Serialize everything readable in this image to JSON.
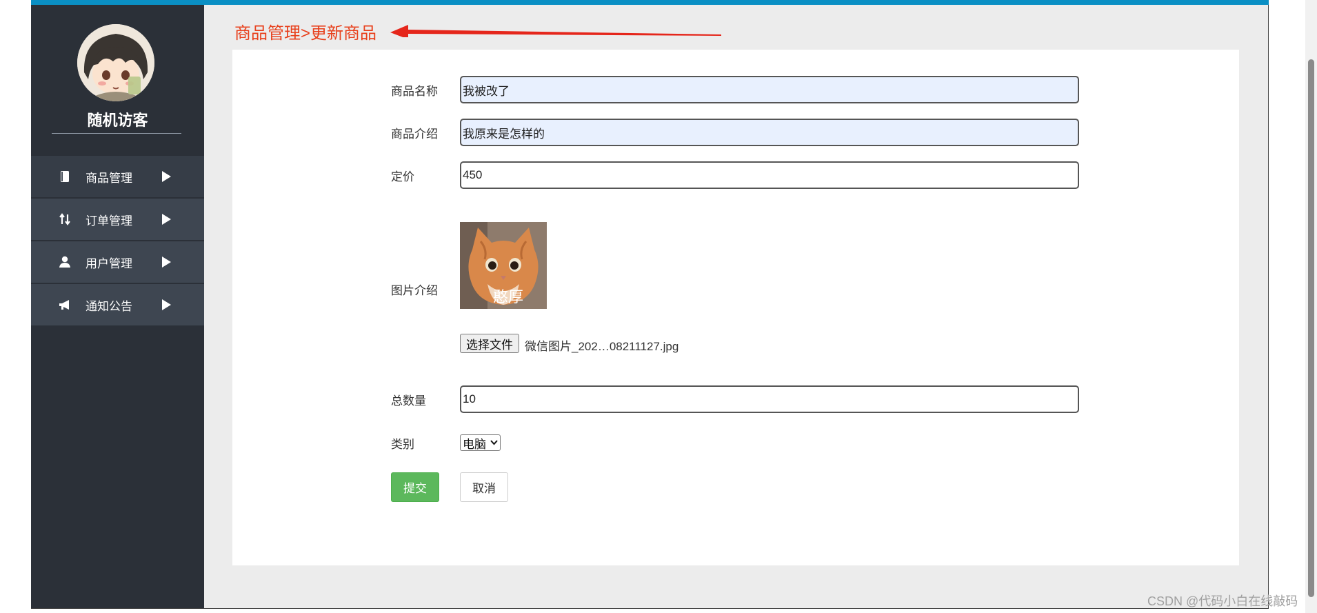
{
  "sidebar": {
    "username": "随机访客",
    "items": [
      {
        "label": "商品管理",
        "icon": "book-icon"
      },
      {
        "label": "订单管理",
        "icon": "sort-arrows-icon"
      },
      {
        "label": "用户管理",
        "icon": "user-icon"
      },
      {
        "label": "通知公告",
        "icon": "megaphone-icon"
      }
    ]
  },
  "breadcrumb": "商品管理>更新商品",
  "form": {
    "name_label": "商品名称",
    "name_value": "我被改了",
    "desc_label": "商品介绍",
    "desc_value": "我原来是怎样的",
    "price_label": "定价",
    "price_value": "450",
    "image_label": "图片介绍",
    "image_caption": "憨厚",
    "file_button": "选择文件",
    "file_name": "微信图片_202…08211127.jpg",
    "total_label": "总数量",
    "total_value": "10",
    "category_label": "类别",
    "category_value": "电脑",
    "submit_label": "提交",
    "cancel_label": "取消"
  },
  "watermark": "CSDN @代码小白在线敲码",
  "colors": {
    "topbar": "#0a8fc4",
    "sidebar": "#2b3038",
    "breadcrumb": "#e8401c",
    "submit": "#5cb85c"
  }
}
